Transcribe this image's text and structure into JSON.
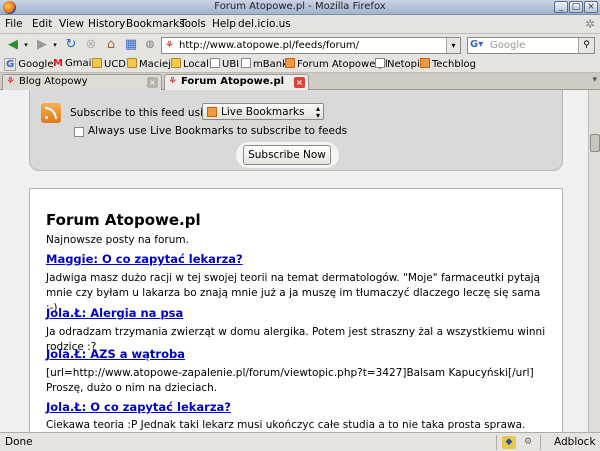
{
  "window": {
    "title": "Forum Atopowe.pl - Mozilla Firefox"
  },
  "menu": [
    "File",
    "Edit",
    "View",
    "History",
    "Bookmarks",
    "Tools",
    "Help",
    "del.icio.us"
  ],
  "nav": {
    "url": "http://www.atopowe.pl/feeds/forum/",
    "search_placeholder": "Google"
  },
  "bookmarks": [
    "Google",
    "Gmail",
    "UCD",
    "Maciej",
    "Local",
    "UBI",
    "mBank",
    "Forum Atopowe.pl",
    "Netopia",
    "Techblog"
  ],
  "tabs": [
    {
      "label": "Blog Atopowy",
      "active": false
    },
    {
      "label": "Forum Atopowe.pl",
      "active": true
    }
  ],
  "subscribe": {
    "label": "Subscribe to this feed using",
    "selected": "Live Bookmarks",
    "always_label": "Always use Live Bookmarks to subscribe to feeds",
    "button": "Subscribe Now"
  },
  "feed": {
    "title": "Forum Atopowe.pl",
    "subtitle": "Najnowsze posty na forum.",
    "entries": [
      {
        "title": "Maggie: O co zapytać lekarza?",
        "body": "Jadwiga masz dużo racji w tej swojej teorii na temat dermatologów. \"Moje\" farmaceutki pytają mnie czy byłam u lakarza bo znają mnie już a ja muszę im tłumaczyć dlaczego leczę się sama ;-)"
      },
      {
        "title": "Jola.Ł: Alergia na psa",
        "body": "Ja odradzam trzymania zwierząt w domu alergika. Potem jest straszny żal a wszystkiemu winni rodzice :?"
      },
      {
        "title": "Jola.Ł: AZS a wątroba",
        "body": "[url=http://www.atopowe-zapalenie.pl/forum/viewtopic.php?t=3427]Balsam Kapucyński[/url] Proszę, dużo o nim na dzieciach."
      },
      {
        "title": "Jola.Ł: O co zapytać lekarza?",
        "body": "Ciekawa teoria :P Jednak taki lekarz musi ukończyc całe studia a to nie taka prosta sprawa. Dopiero potem"
      }
    ]
  },
  "status": {
    "text": "Done",
    "adblock": "Adblock"
  },
  "colors": {
    "link": "#0000cc",
    "rss": "#f29a3c",
    "title_bar": "#9fb3cf"
  }
}
